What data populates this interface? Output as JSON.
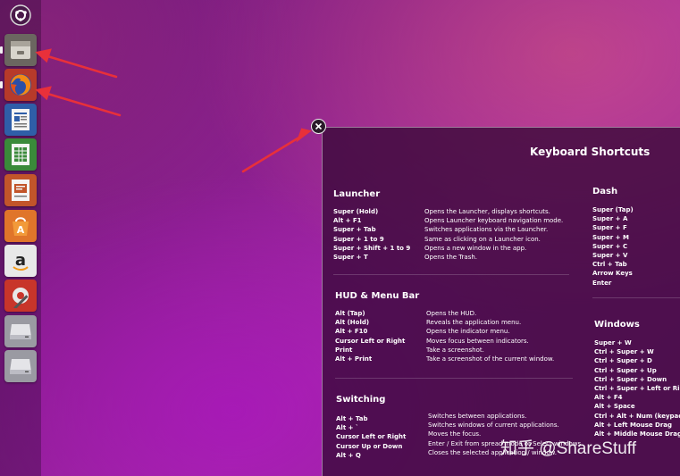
{
  "overlay": {
    "title": "Keyboard Shortcuts",
    "launcher": {
      "title": "Launcher",
      "items": [
        {
          "key": "Super (Hold)",
          "desc": "Opens the Launcher, displays shortcuts."
        },
        {
          "key": "Alt + F1",
          "desc": "Opens Launcher keyboard navigation mode."
        },
        {
          "key": "Super + Tab",
          "desc": "Switches applications via the Launcher."
        },
        {
          "key": "Super + 1 to 9",
          "desc": "Same as clicking on a Launcher icon."
        },
        {
          "key": "Super + Shift + 1 to 9",
          "desc": "Opens a new window in the app."
        },
        {
          "key": "Super + T",
          "desc": "Opens the Trash."
        }
      ]
    },
    "hud": {
      "title": "HUD & Menu Bar",
      "items": [
        {
          "key": "Alt (Tap)",
          "desc": "Opens the HUD."
        },
        {
          "key": "Alt (Hold)",
          "desc": "Reveals the application menu."
        },
        {
          "key": "Alt + F10",
          "desc": "Opens the indicator menu."
        },
        {
          "key": "Cursor Left or Right",
          "desc": "Moves focus between indicators."
        },
        {
          "key": "Print",
          "desc": "Take a screenshot."
        },
        {
          "key": "Alt + Print",
          "desc": "Take a screenshot of the current window."
        }
      ]
    },
    "switching": {
      "title": "Switching",
      "items": [
        {
          "key": "Alt + Tab",
          "desc": "Switches between applications."
        },
        {
          "key": "Alt + `",
          "desc": "Switches windows of current applications."
        },
        {
          "key": "Cursor Left or Right",
          "desc": "Moves the focus."
        },
        {
          "key": "Cursor Up or Down",
          "desc": "Enter / Exit from spread mode or Select windows."
        },
        {
          "key": "Alt + Q",
          "desc": "Closes the selected application / window."
        }
      ]
    },
    "dash": {
      "title": "Dash",
      "keys": [
        "Super (Tap)",
        "Super + A",
        "Super + F",
        "Super + M",
        "Super + C",
        "Super + V",
        "Ctrl + Tab",
        "Arrow Keys",
        "Enter"
      ]
    },
    "windows": {
      "title": "Windows",
      "keys": [
        "Super + W",
        "Ctrl + Super + W",
        "Ctrl + Super + D",
        "Ctrl + Super + Up",
        "Ctrl + Super + Down",
        "Ctrl + Super + Left or Right",
        "Alt + F4",
        "Alt + Space",
        "Ctrl + Alt + Num (keypad)",
        "Alt + Left Mouse Drag",
        "Alt + Middle Mouse Drag"
      ]
    }
  },
  "watermark": "知乎 @ShareStuff",
  "launcher_icons": [
    "ubuntu-logo-icon",
    "files-icon",
    "firefox-icon",
    "writer-icon",
    "calc-icon",
    "impress-icon",
    "software-center-icon",
    "amazon-icon",
    "system-settings-icon",
    "drive-icon",
    "drive-icon"
  ],
  "colors": {
    "accent_arrow": "#e8303a",
    "overlay_bg": "#370837"
  }
}
